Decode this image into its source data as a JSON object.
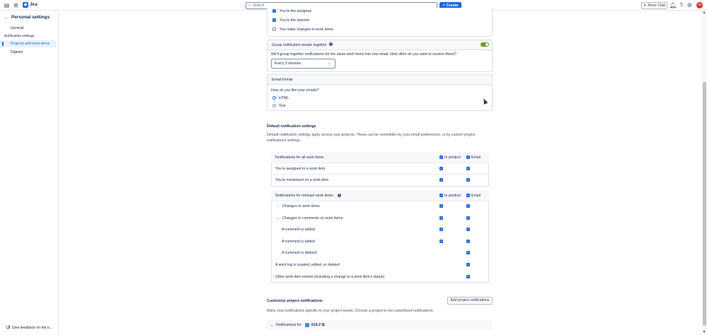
{
  "topbar": {
    "app_name": "Jira",
    "search_placeholder": "Search",
    "create_label": "Create",
    "rovo_label": "Rovo Chat",
    "avatar_initials": "TG"
  },
  "sidebar": {
    "title": "Personal settings",
    "general": "General",
    "section_label": "Notification settings",
    "projects_item": "Projects and work items",
    "digests": "Digests",
    "feedback": "Give feedback on the n..."
  },
  "work_items_list": {
    "assignee_partial": "You're the assignee",
    "reporter": "You're the reporter",
    "changes": "You make changes to work items"
  },
  "group_card": {
    "title": "Group notification emails together",
    "description": "We'll group together notifications for the same work items into one email. How often do you want to receive these?",
    "select_value": "Every 3 minutes"
  },
  "email_format": {
    "title": "Email format",
    "question": "How do you like your emails?",
    "options": [
      "HTML",
      "Text"
    ],
    "selected": "HTML"
  },
  "defaults": {
    "heading": "Default notification settings",
    "description_line1": "Default notification settings apply across your projects. These can be overridden by your email preferences, or by custom project",
    "description_line2": "notifications settings.",
    "col_in_product": "In product",
    "col_email": "Email",
    "all_group_label": "Notifications for all work items",
    "assigned": "You're assigned to a work item",
    "mentioned": "You're mentioned on a work item",
    "relevant_group_label": "Notifications for relevant work items",
    "changes_to_work_items": "Changes to work items",
    "changes_to_comments": "Changes to comments on work items",
    "comment_added": "A comment is added",
    "comment_edited": "A comment is edited",
    "comment_deleted": "A comment is deleted",
    "work_log": "A work log is created, edited, or deleted",
    "other_events": "Other work item events (including a change to a work item's status)"
  },
  "customize": {
    "heading": "Customize project notifications",
    "add_button": "Add project notifications",
    "description": "Make your notifications specific to your project needs. Choose a project to set customized notifications.",
    "notifications_for": "Notifications for",
    "project_name": "619.2 IE"
  }
}
